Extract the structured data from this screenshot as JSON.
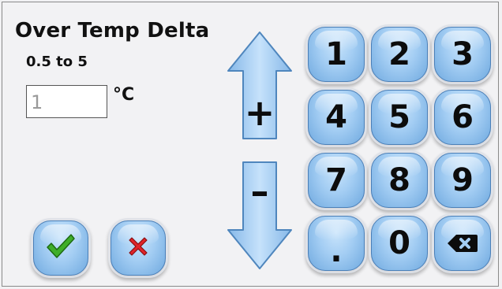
{
  "dialog": {
    "title": "Over Temp Delta",
    "range": "0.5 to 5",
    "value": "1",
    "unit": "°C"
  },
  "arrows": {
    "increase_label": "+",
    "decrease_label": "–"
  },
  "keypad": {
    "k1": "1",
    "k2": "2",
    "k3": "3",
    "k4": "4",
    "k5": "5",
    "k6": "6",
    "k7": "7",
    "k8": "8",
    "k9": "9",
    "kdot": ".",
    "k0": "0"
  },
  "icons": {
    "confirm": "checkmark-icon",
    "cancel": "x-icon",
    "backspace": "backspace-icon"
  },
  "colors": {
    "key_blue": "#a3cdf3",
    "confirm_green": "#3fae2a",
    "cancel_red": "#e0242a",
    "input_text": "#9a9a9a"
  }
}
